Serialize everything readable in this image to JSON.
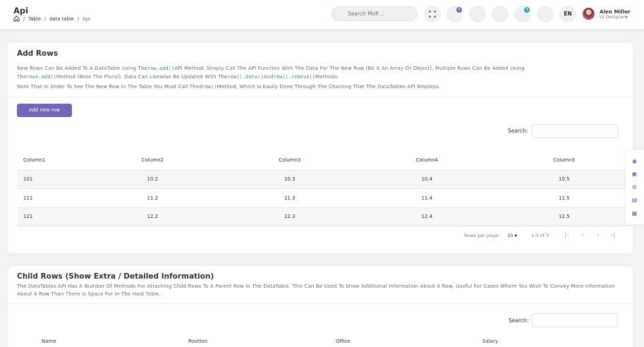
{
  "header": {
    "page_title": "Api",
    "breadcrumb": [
      "Table",
      "data table",
      "Api"
    ],
    "search_placeholder": "Search Mofi ..",
    "notification_count": "4",
    "message_count": "3",
    "language": "EN",
    "user": {
      "name": "Alen Miller",
      "role": "UI Designer"
    },
    "accent_color": "#7366b8"
  },
  "card1": {
    "title": "Add Rows",
    "desc_line1": [
      "New Rows Can Be Added To A DataTable Using The",
      "row.add()",
      "API Method. Simply Call The API Function With The Data For The New Row (Be It An Array Or Object). Multiple Rows Can Be Added Using"
    ],
    "desc_line2": [
      "The",
      "rows.add()",
      "Method (Note The Plural). Data Can Likewise Be Updated With The",
      "row().data()",
      "And",
      "row().remove()",
      "Methods."
    ],
    "desc_line3": [
      "Note That In Order To See The New Row In The Table You Must Call The",
      "draw()",
      "Method, Which Is Easily Done Through The Chaining That The DataTables API Employs."
    ],
    "add_button": "Add new row",
    "search_label": "Search:",
    "columns": [
      "Column1",
      "Column2",
      "Column3",
      "Column4",
      "Column5"
    ],
    "rows": [
      [
        "101",
        "10.2",
        "10.3",
        "10.4",
        "10.5"
      ],
      [
        "111",
        "11.2",
        "11.3",
        "11.4",
        "11.5"
      ],
      [
        "121",
        "12.2",
        "12.3",
        "12.4",
        "12.5"
      ]
    ],
    "rows_per_page_label": "Rows per page:",
    "rows_per_page": "10",
    "range": "1-3 of 3"
  },
  "card2": {
    "title": "Child Rows (Show Extra / Detailed Information)",
    "desc": "The DataTables API Has A Number Of Methods For Attaching Child Rows To A Parent Row In The DataTable. This Can Be Used To Show Additional Information About A Row, Useful For Cases Where You Wish To Convey More Information About A Row Than There Is Space For In The Host Table.",
    "search_label": "Search:",
    "columns": [
      "Name",
      "Position",
      "Office",
      "Salary"
    ]
  }
}
